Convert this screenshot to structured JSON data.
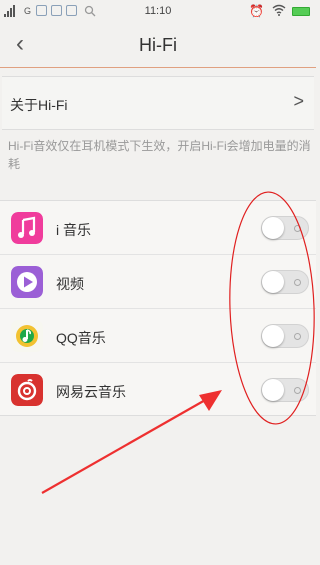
{
  "status_bar": {
    "network": "G",
    "time": "11:10",
    "alarm_icon": "alarm-clock-icon",
    "wifi_icon": "wifi-icon",
    "battery_icon": "battery-icon"
  },
  "header": {
    "back_icon": "chevron-left-icon",
    "back_glyph": "‹",
    "title": "Hi-Fi"
  },
  "about": {
    "label": "关于Hi-Fi",
    "chevron": ">"
  },
  "description": "Hi-Fi音效仅在耳机模式下生效，开启Hi-Fi会增加电量的消耗",
  "apps": [
    {
      "label": "i 音乐",
      "icon": "music-note-icon",
      "color": "#f03c9c",
      "enabled": false
    },
    {
      "label": "视频",
      "icon": "play-icon",
      "color": "#9b5fd6",
      "enabled": false
    },
    {
      "label": "QQ音乐",
      "icon": "qq-music-icon",
      "color": "#f2c230",
      "enabled": false
    },
    {
      "label": "网易云音乐",
      "icon": "netease-music-icon",
      "color": "#d8322f",
      "enabled": false
    }
  ],
  "annotation": {
    "ellipse_color": "#e02020",
    "arrow_color": "#ee3030"
  }
}
